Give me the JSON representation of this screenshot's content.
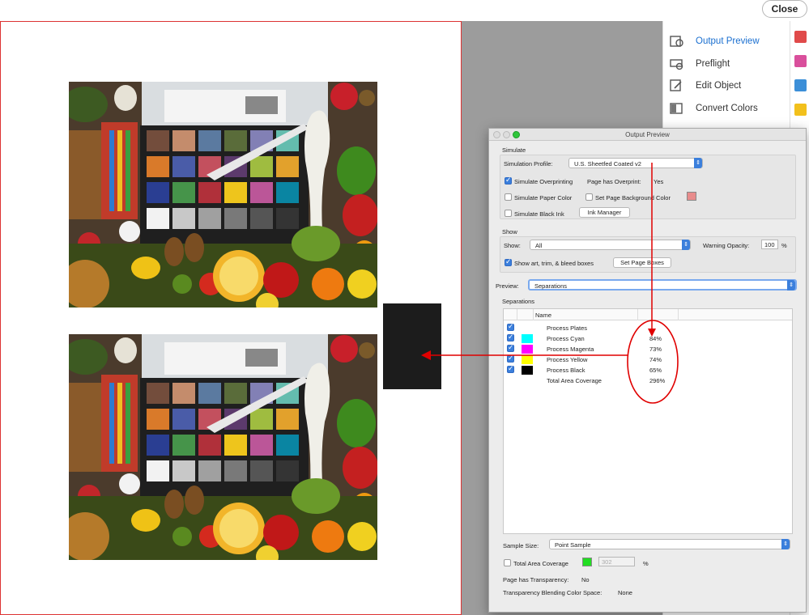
{
  "toolbar": {
    "close_label": "Close"
  },
  "tools_panel": {
    "items": [
      {
        "label": "Output Preview",
        "icon": "output-preview-icon",
        "active": true
      },
      {
        "label": "Preflight",
        "icon": "preflight-icon",
        "active": false
      },
      {
        "label": "Edit Object",
        "icon": "edit-object-icon",
        "active": false
      },
      {
        "label": "Convert Colors",
        "icon": "convert-colors-icon",
        "active": false
      }
    ]
  },
  "dialog": {
    "title": "Output Preview",
    "simulate": {
      "section_label": "Simulate",
      "profile_label": "Simulation Profile:",
      "profile_value": "U.S. Sheetfed Coated v2",
      "overprinting_label": "Simulate Overprinting",
      "overprinting_checked": true,
      "page_overprint_label": "Page has Overprint:",
      "page_overprint_value": "Yes",
      "paper_color_label": "Simulate Paper Color",
      "page_bg_label": "Set Page Background Color",
      "black_ink_label": "Simulate Black Ink",
      "ink_manager_label": "Ink Manager",
      "page_bg_swatch_color": "#e88c8c"
    },
    "show": {
      "section_label": "Show",
      "show_label": "Show:",
      "show_value": "All",
      "warning_opacity_label": "Warning Opacity:",
      "warning_opacity_value": "100",
      "percent": "%",
      "art_trim_label": "Show art, trim, & bleed boxes",
      "art_trim_checked": true,
      "set_page_boxes_label": "Set Page Boxes"
    },
    "preview": {
      "label": "Preview:",
      "value": "Separations"
    },
    "separations": {
      "section_label": "Separations",
      "name_header": "Name",
      "rows": [
        {
          "name": "Process Plates",
          "percent": "",
          "color": "",
          "checked": true
        },
        {
          "name": "Process Cyan",
          "percent": "84%",
          "color": "#00ffff",
          "checked": true
        },
        {
          "name": "Process Magenta",
          "percent": "73%",
          "color": "#ff00ff",
          "checked": true
        },
        {
          "name": "Process Yellow",
          "percent": "74%",
          "color": "#ffff00",
          "checked": true
        },
        {
          "name": "Process Black",
          "percent": "65%",
          "color": "#000000",
          "checked": true
        },
        {
          "name": "Total Area Coverage",
          "percent": "296%",
          "color": "",
          "checked": false
        }
      ]
    },
    "sample_size": {
      "label": "Sample Size:",
      "value": "Point Sample"
    },
    "tac": {
      "label": "Total Area Coverage",
      "value": "302",
      "percent": "%",
      "swatch_color": "#22dd22"
    },
    "transparency": {
      "label": "Page has Transparency:",
      "value": "No"
    },
    "blending": {
      "label": "Transparency Blending Color Space:",
      "value": "None"
    }
  },
  "colors": {
    "annotation_red": "#e00000",
    "page_border": "#dd3333"
  }
}
